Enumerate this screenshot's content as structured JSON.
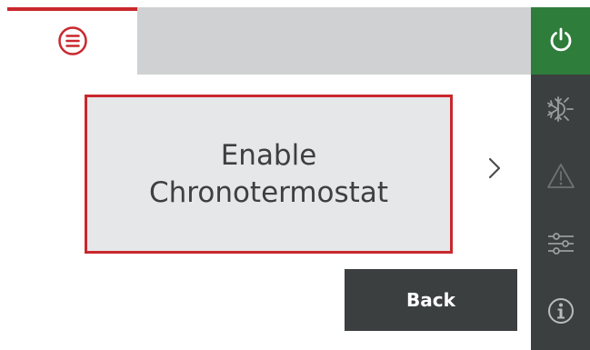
{
  "header": {
    "menu_icon": "menu-circle-icon",
    "accent_color": "#c9282d"
  },
  "main": {
    "option_label": "Enable\nChronotermostat",
    "next_icon": "chevron-right-icon"
  },
  "footer": {
    "back_label": "Back"
  },
  "rail": {
    "items": [
      {
        "icon": "power-icon",
        "active": true,
        "color": "#2e7d3a"
      },
      {
        "icon": "sun-snowflake-icon"
      },
      {
        "icon": "warning-icon"
      },
      {
        "icon": "sliders-icon"
      },
      {
        "icon": "info-icon"
      }
    ]
  }
}
